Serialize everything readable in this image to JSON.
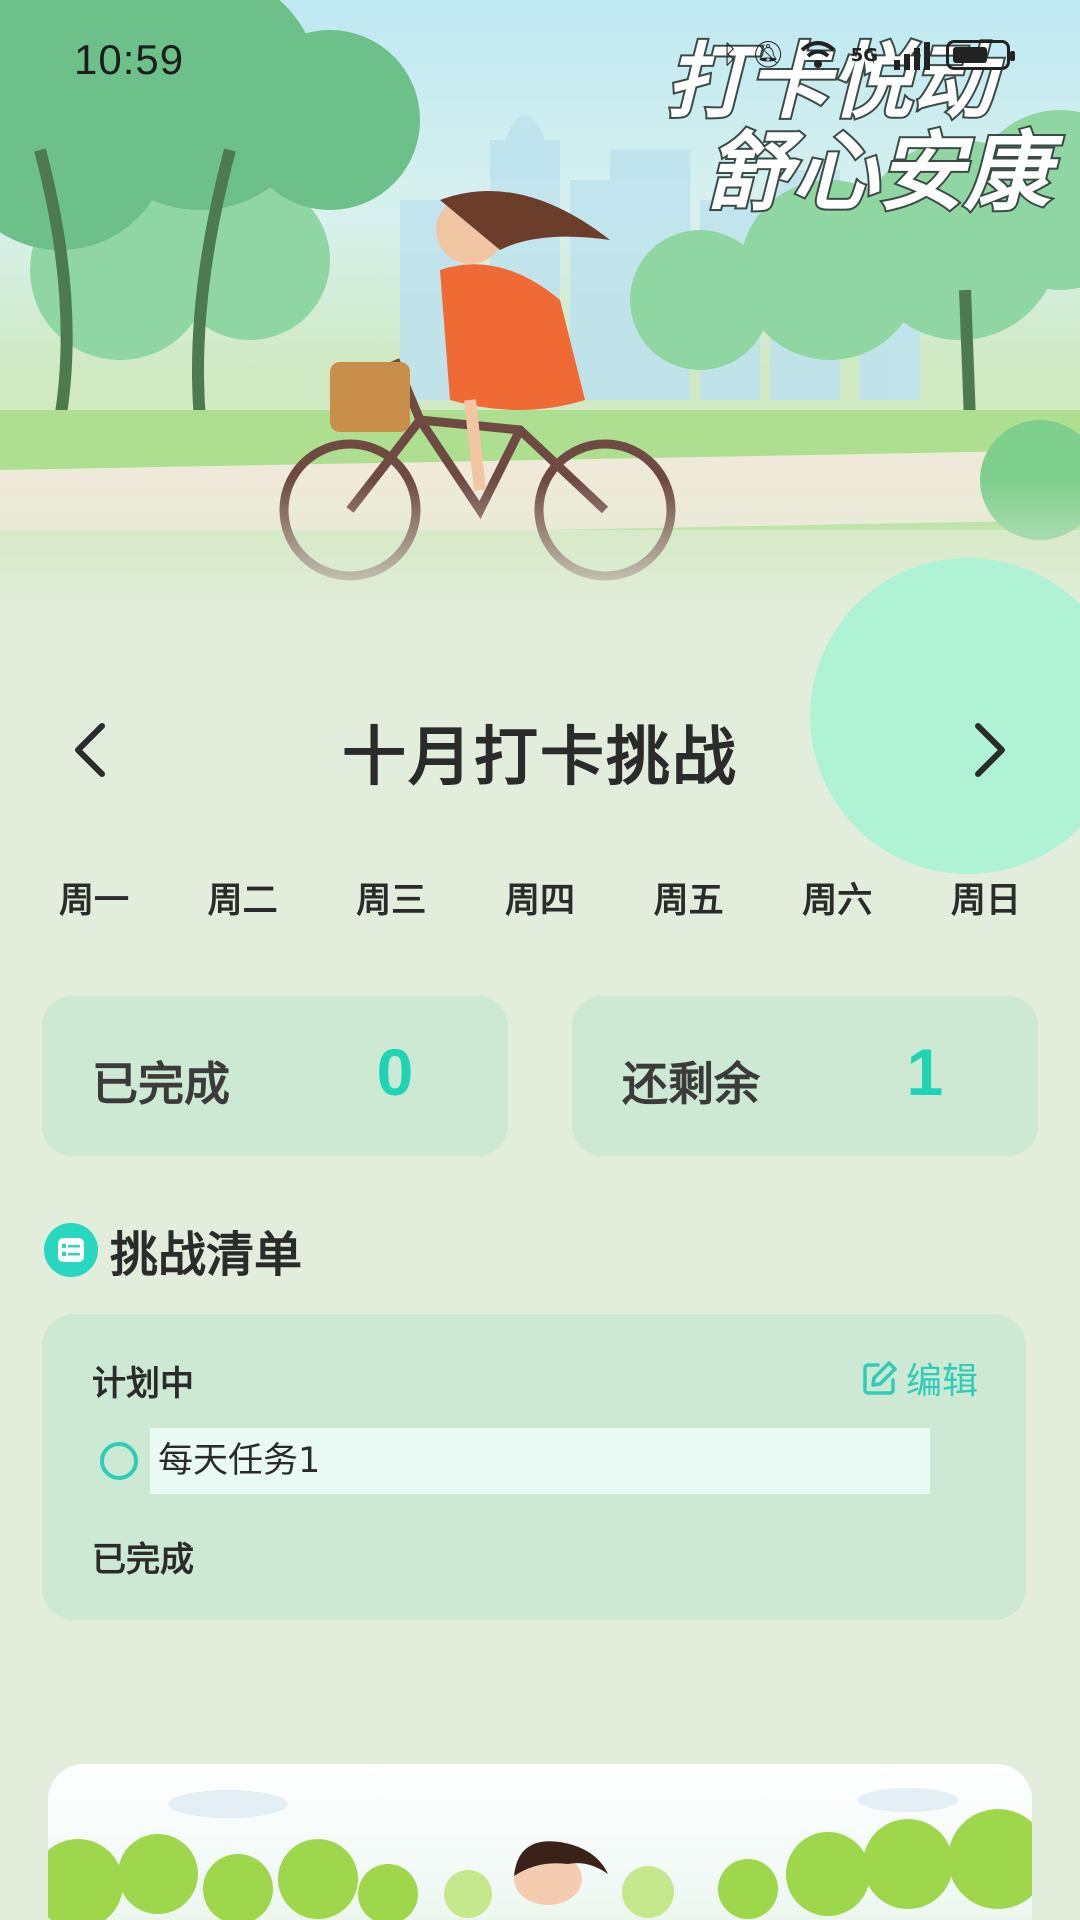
{
  "status_bar": {
    "time": "10:59",
    "network": "5G"
  },
  "hero": {
    "slogan_line1": "打卡悦动",
    "slogan_line2": "舒心安康"
  },
  "month": {
    "title": "十月打卡挑战"
  },
  "weekdays": [
    "周一",
    "周二",
    "周三",
    "周四",
    "周五",
    "周六",
    "周日"
  ],
  "stats": {
    "completed_label": "已完成",
    "completed_value": "0",
    "remaining_label": "还剩余",
    "remaining_value": "1"
  },
  "challenge_list": {
    "title": "挑战清单",
    "edit_label": "编辑",
    "planned_label": "计划中",
    "done_label": "已完成",
    "tasks": [
      "每天任务1"
    ]
  },
  "colors": {
    "accent": "#1fd4b5",
    "card": "#cde9d4",
    "background": "#e3eddc",
    "deco_circle": "#b0f2d6"
  },
  "icons": [
    "bluetooth-icon",
    "mute-icon",
    "wifi-icon",
    "signal-icon",
    "battery-icon",
    "chevron-left-icon",
    "chevron-right-icon",
    "checklist-icon",
    "edit-icon",
    "radio-unchecked-icon"
  ]
}
